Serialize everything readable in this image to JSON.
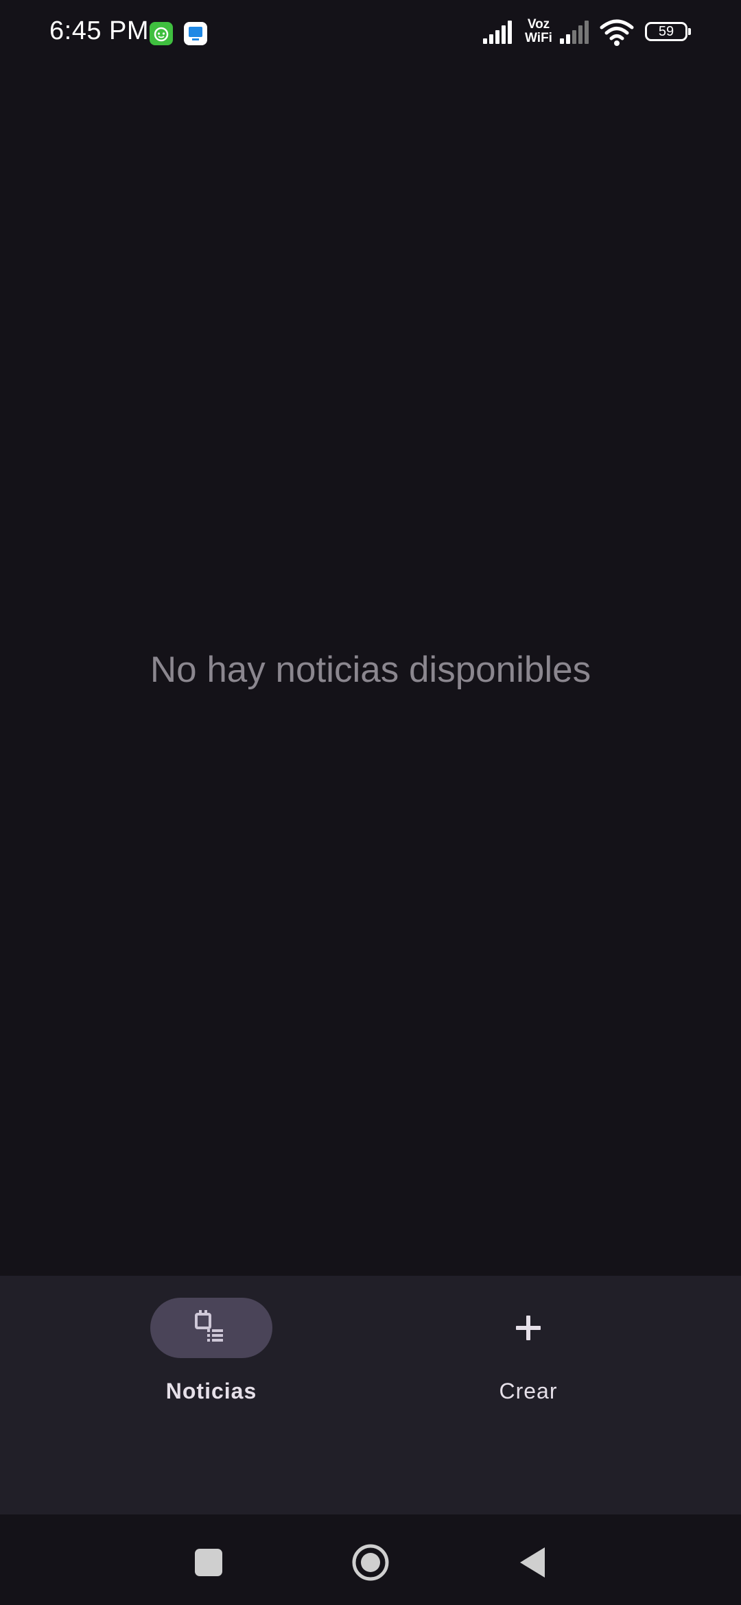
{
  "status_bar": {
    "time": "6:45 PM",
    "voz_line1": "Voz",
    "voz_line2": "WiFi",
    "battery": "59"
  },
  "main": {
    "empty_message": "No hay noticias disponibles"
  },
  "bottom_nav": {
    "items": [
      {
        "label": "Noticias",
        "icon": "news-list-icon",
        "selected": true
      },
      {
        "label": "Crear",
        "icon": "add-icon",
        "selected": false
      }
    ]
  },
  "system_nav": {
    "buttons": [
      "recents-icon",
      "home-icon",
      "back-icon"
    ]
  },
  "colors": {
    "background": "#141218",
    "nav_background": "#211f28",
    "indicator": "#4a4458",
    "muted_text": "#8b878f"
  }
}
